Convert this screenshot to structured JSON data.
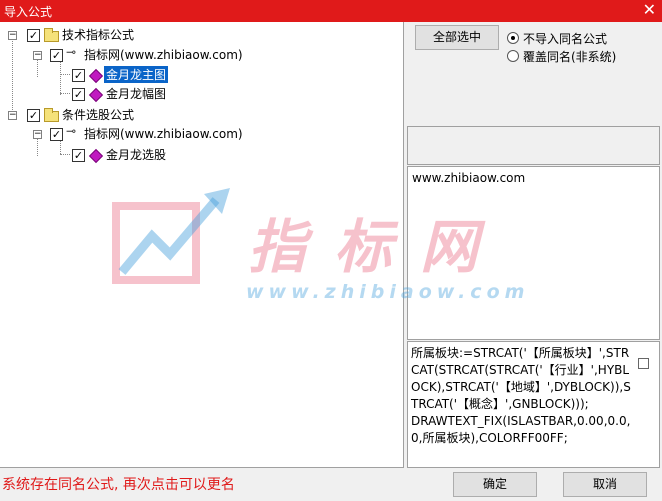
{
  "window": {
    "title": "导入公式",
    "close_glyph": "✕"
  },
  "tree": {
    "group1": {
      "label": "技术指标公式",
      "site": "指标网(www.zhibiaow.com)",
      "items": [
        "金月龙主图",
        "金月龙幅图"
      ]
    },
    "group2": {
      "label": "条件选股公式",
      "site": "指标网(www.zhibiaow.com)",
      "items": [
        "金月龙选股"
      ]
    }
  },
  "controls": {
    "select_all": "全部选中",
    "radio_skip": "不导入同名公式",
    "radio_overwrite": "覆盖同名(非系统)"
  },
  "info": {
    "url": "www.zhibiaow.com"
  },
  "code_text": "所属板块:=STRCAT('【所属板块】',STRCAT(STRCAT(STRCAT('【行业】',HYBLOCK),STRCAT('【地域】',DYBLOCK)),STRCAT('【概念】',GNBLOCK)));\nDRAWTEXT_FIX(ISLASTBAR,0.00,0.0,0,所属板块),COLORFF00FF;",
  "status_message": "系统存在同名公式, 再次点击可以更名",
  "buttons": {
    "ok": "确定",
    "cancel": "取消"
  },
  "watermark": {
    "cn": "指标网",
    "url": "www.zhibiaow.com"
  }
}
